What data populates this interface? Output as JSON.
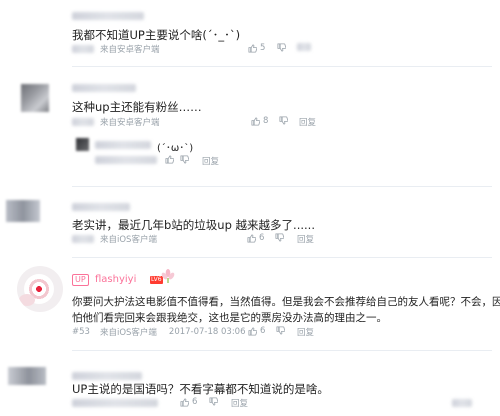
{
  "comments": [
    {
      "content": "我都不知道UP主要说个啥(´･_･`)",
      "source": "来自安卓客户端",
      "likes": "5",
      "reply_label": ""
    },
    {
      "content": "这种up主还能有粉丝……",
      "source": "来自安卓客户端",
      "likes": "8",
      "reply_label": "回复",
      "reply": {
        "content": "(´･ω･`)",
        "reply_label": "回复"
      }
    },
    {
      "content": "老实讲，最近几年b站的垃圾up 越来越多了......",
      "source": "来自iOS客户端",
      "likes": "6",
      "reply_label": "回复"
    },
    {
      "up_badge": "UP",
      "username": "flashyiyi",
      "level": "LV6",
      "content_line1": "你要问大护法这电影值不值得看，当然值得。但是我会不会推荐给自己的友人看呢？不会，因为我",
      "content_line2": "怕他们看完回来会跟我绝交，这也是它的票房没办法高的理由之一。",
      "floor": "#53",
      "source": "来自iOS客户端",
      "timestamp": "2017-07-18 03:06",
      "likes": "6",
      "reply_label": "回复"
    },
    {
      "content": "UP主说的是国语吗？不看字幕都不知道说的是啥。",
      "likes": "6",
      "reply_label": "回复"
    }
  ],
  "colors": {
    "accent_pink": "#fb7299",
    "meta_gray": "#99a2aa",
    "divider": "#e9edf2"
  }
}
